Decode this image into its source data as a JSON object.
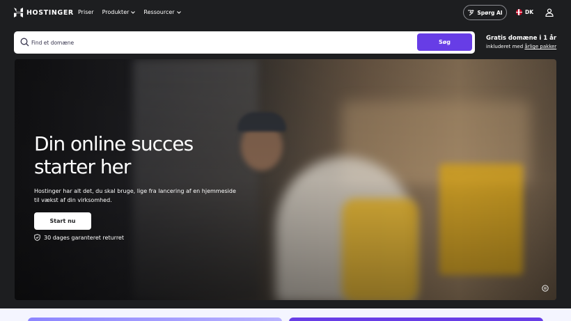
{
  "nav": {
    "brand": "HOSTINGER",
    "links": [
      {
        "label": "Priser"
      },
      {
        "label": "Produkter"
      },
      {
        "label": "Ressourcer"
      }
    ],
    "ask_ai": "Spørg AI",
    "language": "DK"
  },
  "search": {
    "placeholder": "Find et domæne",
    "button": "Søg"
  },
  "promo": {
    "title": "Gratis domæne i 1 år",
    "subtitle_prefix": "inkluderet med",
    "subtitle_link": "årlige pakker"
  },
  "hero": {
    "title": "Din online succes starter her",
    "description": "Hostinger har alt det, du skal bruge, lige fra lancering af en hjemmeside til vækst af din virksomhed.",
    "cta": "Start nu",
    "guarantee": "30 dages garanteret returret"
  },
  "colors": {
    "background": "#1d1e20",
    "accent": "#673de6",
    "white": "#ffffff"
  }
}
